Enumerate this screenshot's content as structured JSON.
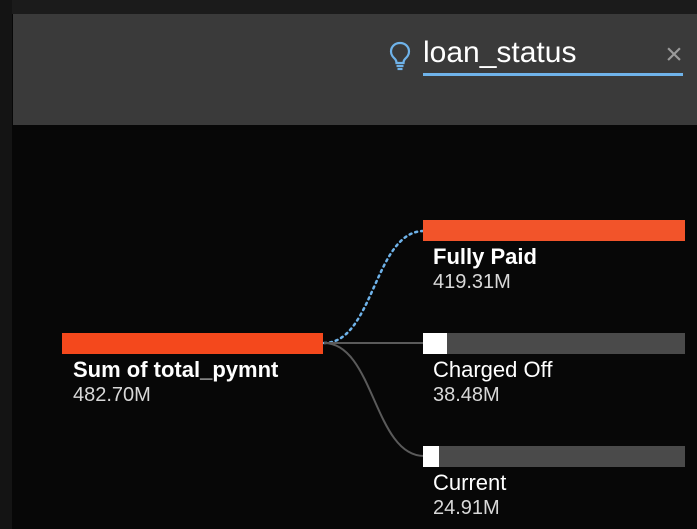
{
  "search": {
    "value": "loan_status",
    "icon": "lightbulb-icon",
    "close_glyph": "×",
    "close_icon": "close-icon"
  },
  "colors": {
    "accent_orange": "#f2542a",
    "root_orange": "#f4481c",
    "track_gray": "#4a4a4a",
    "highlight_blue": "#6fb3ea",
    "link_gray": "#5a5a5a"
  },
  "root": {
    "label": "Sum of total_pymnt",
    "value": "482.70M",
    "fill_fraction": 1.0
  },
  "children": [
    {
      "label": "Fully Paid",
      "value": "419.31M",
      "fill_fraction": 1.0,
      "highlighted": true
    },
    {
      "label": "Charged Off",
      "value": "38.48M",
      "fill_fraction": 0.09,
      "highlighted": false
    },
    {
      "label": "Current",
      "value": "24.91M",
      "fill_fraction": 0.06,
      "highlighted": false
    }
  ]
}
